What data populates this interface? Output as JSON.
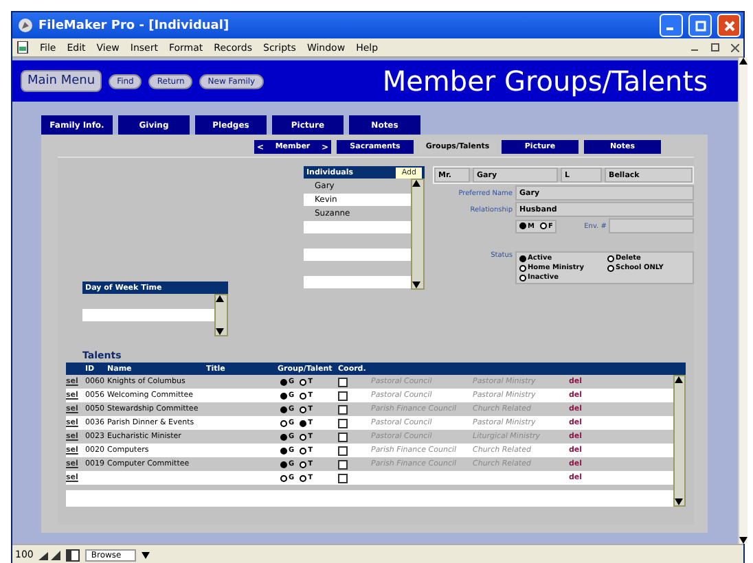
{
  "window": {
    "title": "FileMaker Pro - [Individual]"
  },
  "menu": [
    "File",
    "Edit",
    "View",
    "Insert",
    "Format",
    "Records",
    "Scripts",
    "Window",
    "Help"
  ],
  "header": {
    "main_button": "Main Menu",
    "buttons": [
      "Find",
      "Return",
      "New Family"
    ],
    "title": "Member Groups/Talents"
  },
  "tabs": [
    {
      "label": "Family Info.",
      "selected": false
    },
    {
      "label": "Giving",
      "selected": false
    },
    {
      "label": "Pledges",
      "selected": false
    },
    {
      "label": "Picture",
      "selected": false
    },
    {
      "label": "Notes",
      "selected": false
    }
  ],
  "subtabs": [
    {
      "label": "Member",
      "prev": "<",
      "next": ">",
      "selected": false
    },
    {
      "label": "Sacraments",
      "selected": false
    },
    {
      "label": "Groups/Talents",
      "selected": true
    },
    {
      "label": "Picture",
      "selected": false
    },
    {
      "label": "Notes",
      "selected": false
    }
  ],
  "schedule": {
    "header": "Day of Week  Time"
  },
  "individuals": {
    "header": "Individuals",
    "add": "Add",
    "items": [
      "Gary",
      "Kevin",
      "Suzanne"
    ]
  },
  "person": {
    "prefix": "Mr.",
    "first": "Gary",
    "middle": "L",
    "last": "Bellack",
    "preferred_label": "Preferred Name",
    "preferred": "Gary",
    "relationship_label": "Relationship",
    "relationship": "Husband",
    "gender": [
      {
        "label": "M",
        "selected": true
      },
      {
        "label": "F",
        "selected": false
      }
    ],
    "env_label": "Env. #"
  },
  "status": {
    "label": "Status",
    "options": [
      {
        "label": "Active",
        "selected": true
      },
      {
        "label": "Delete",
        "selected": false
      },
      {
        "label": "Home Ministry",
        "selected": false
      },
      {
        "label": "School ONLY",
        "selected": false
      },
      {
        "label": "Inactive",
        "selected": false
      }
    ]
  },
  "talents": {
    "title": "Talents",
    "columns": [
      "ID",
      "Name",
      "Title",
      "Group/Talent",
      "Coord."
    ],
    "rows": [
      {
        "sel": "sel",
        "id": "0060",
        "name": "Knights of Columbus",
        "group": {
          "label": "G",
          "selected": true
        },
        "talent": {
          "label": "T",
          "selected": false
        },
        "coord": false,
        "council": "Pastoral Council",
        "ministry": "Pastoral Ministry",
        "del": "del"
      },
      {
        "sel": "sel",
        "id": "0056",
        "name": "Welcoming Committee",
        "group": {
          "label": "G",
          "selected": true
        },
        "talent": {
          "label": "T",
          "selected": false
        },
        "coord": false,
        "council": "Pastoral Council",
        "ministry": "Pastoral Ministry",
        "del": "del"
      },
      {
        "sel": "sel",
        "id": "0050",
        "name": "Stewardship Committee",
        "group": {
          "label": "G",
          "selected": true
        },
        "talent": {
          "label": "T",
          "selected": false
        },
        "coord": false,
        "council": "Parish Finance Council",
        "ministry": "Church Related",
        "del": "del"
      },
      {
        "sel": "sel",
        "id": "0036",
        "name": "Parish Dinner & Events",
        "group": {
          "label": "G",
          "selected": false
        },
        "talent": {
          "label": "T",
          "selected": true
        },
        "coord": false,
        "council": "Pastoral Council",
        "ministry": "Pastoral Ministry",
        "del": "del"
      },
      {
        "sel": "sel",
        "id": "0023",
        "name": "Eucharistic Minister",
        "group": {
          "label": "G",
          "selected": true
        },
        "talent": {
          "label": "T",
          "selected": false
        },
        "coord": false,
        "council": "Pastoral Council",
        "ministry": "Liturgical Ministry",
        "del": "del"
      },
      {
        "sel": "sel",
        "id": "0020",
        "name": "Computers",
        "group": {
          "label": "G",
          "selected": true
        },
        "talent": {
          "label": "T",
          "selected": false
        },
        "coord": false,
        "council": "Parish Finance Council",
        "ministry": "Church Related",
        "del": "del"
      },
      {
        "sel": "sel",
        "id": "0019",
        "name": "Computer Committee",
        "group": {
          "label": "G",
          "selected": true
        },
        "talent": {
          "label": "T",
          "selected": false
        },
        "coord": false,
        "council": "Parish Finance Council",
        "ministry": "Church Related",
        "del": "del"
      },
      {
        "sel": "sel",
        "id": "",
        "name": "",
        "group": {
          "label": "G",
          "selected": false
        },
        "talent": {
          "label": "T",
          "selected": false
        },
        "coord": false,
        "council": "",
        "ministry": "",
        "del": "del"
      }
    ]
  },
  "status_bar": {
    "zoom": "100",
    "mode": "Browse"
  }
}
